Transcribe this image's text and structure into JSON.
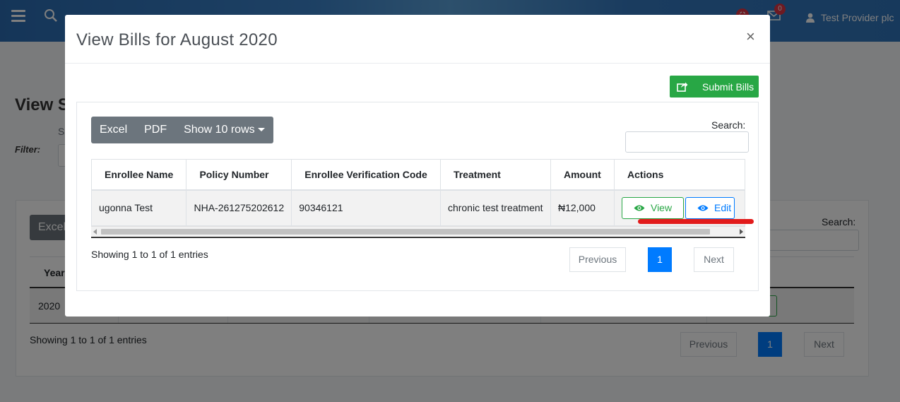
{
  "header": {
    "notification_count": "",
    "mail_count": "0",
    "user_name": "Test Provider plc"
  },
  "background_page": {
    "title_fragment": "View S",
    "select_fragment": "Se",
    "filter_label": "Filter:",
    "excel_label": "Excel",
    "search_label": "Search:",
    "table_header_fragment": "Year",
    "row_year": "2020",
    "showing_text": "Showing 1 to 1 of 1 entries",
    "pagination": {
      "previous": "Previous",
      "page": "1",
      "next": "Next"
    }
  },
  "modal": {
    "title": "View Bills for August 2020",
    "close_symbol": "×",
    "submit_button": "Submit Bills",
    "toolbar": {
      "excel": "Excel",
      "pdf": "PDF",
      "rows": "Show 10 rows"
    },
    "search_label": "Search:",
    "search_value": "",
    "table": {
      "columns": [
        "Enrollee Name",
        "Policy Number",
        "Enrollee Verification Code",
        "Treatment",
        "Amount",
        "Actions"
      ],
      "rows": [
        {
          "enrollee_name": "ugonna Test",
          "policy_number": "NHA-261275202612",
          "verification_code": "90346121",
          "treatment": "chronic test treatment",
          "amount": "₦12,000",
          "view_label": "View",
          "edit_label": "Edit"
        }
      ]
    },
    "showing_text": "Showing 1 to 1 of 1 entries",
    "pagination": {
      "previous": "Previous",
      "page": "1",
      "next": "Next"
    }
  },
  "colors": {
    "success": "#28a745",
    "primary": "#007bff",
    "secondary": "#6c757d",
    "annotation": "#e21b1b"
  },
  "icons": {
    "menu": "hamburger-icon",
    "search": "search-icon",
    "notifications": "bell-icon",
    "mail": "envelope-icon",
    "user": "user-icon",
    "submit": "share-icon",
    "view": "eye-icon",
    "edit": "eye-icon"
  }
}
